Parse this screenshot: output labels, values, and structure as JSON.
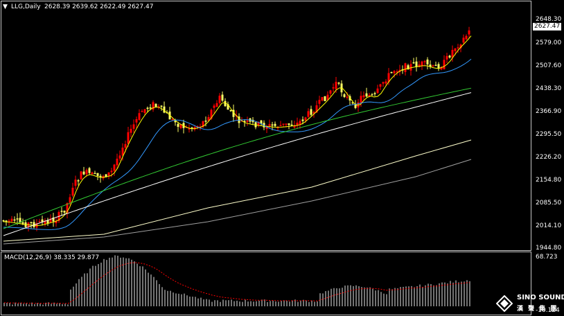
{
  "main_header": {
    "symbol_timeframe": "LLG,Daily",
    "ohlc": "2628.39 2639.62 2622.49 2627.47"
  },
  "price_axis": {
    "labels": [
      "2648.30",
      "2579.00",
      "2507.60",
      "2438.30",
      "2366.90",
      "2295.50",
      "2226.20",
      "2154.80",
      "2085.50",
      "2014.10",
      "1944.80"
    ],
    "current_price": "2627.47"
  },
  "macd_header": {
    "label": "MACD(12,26,9) 38.335 29.877"
  },
  "macd_axis": {
    "top": "68.723",
    "bottom": "-10.124"
  },
  "logo": {
    "brand": "SINO SOUND",
    "sub": "漢 聲 集 團"
  },
  "colors": {
    "background": "#000000",
    "bull_candle": "#ff0000",
    "bear_candle": "#ffff66",
    "ma5": "#ffff00",
    "ma20": "#3399ff",
    "ma40": "#33cc33",
    "ma60": "#ffffff",
    "ma120": "#ffffcc",
    "ma240": "#a0a0a0",
    "macd_hist": "#c0c0c0",
    "macd_signal": "#ff0000"
  }
}
